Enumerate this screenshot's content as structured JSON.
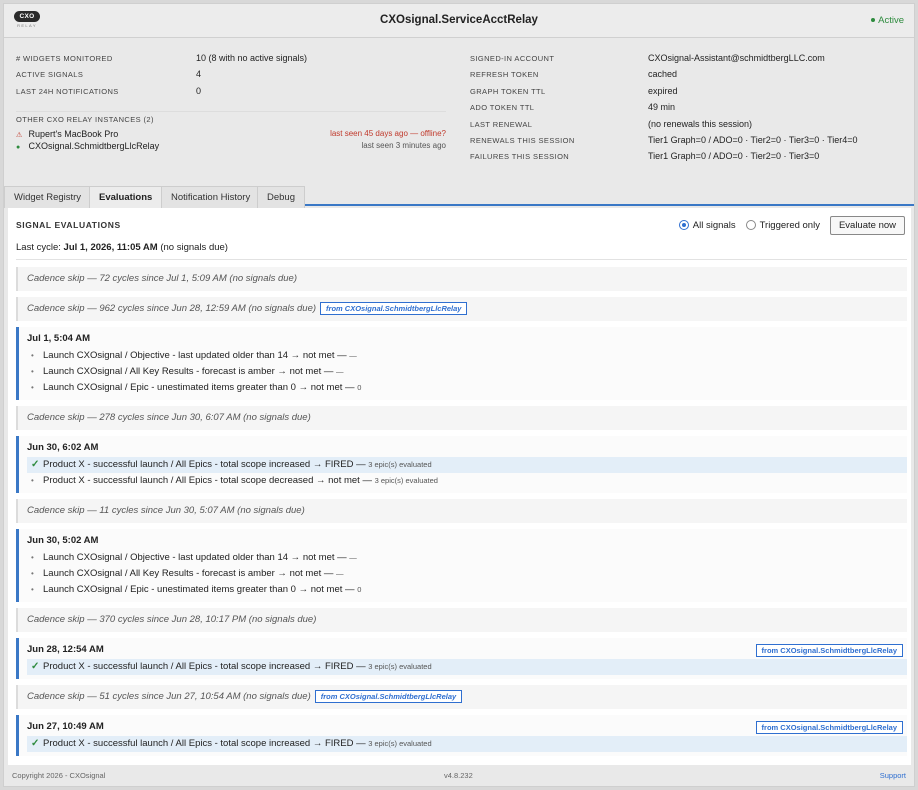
{
  "header": {
    "logo_text": "CXO",
    "logo_sub": "RELAY",
    "title": "CXOsignal.ServiceAcctRelay",
    "status": "Active",
    "status_color": "#2e8b3e"
  },
  "summary": {
    "left": [
      {
        "k": "# WIDGETS MONITORED",
        "v": "10 (8 with no active signals)"
      },
      {
        "k": "ACTIVE SIGNALS",
        "v": "4"
      },
      {
        "k": "LAST 24H NOTIFICATIONS",
        "v": "0"
      }
    ],
    "right": [
      {
        "k": "SIGNED-IN ACCOUNT",
        "v": "CXOsignal-Assistant@schmidtbergLLC.com"
      },
      {
        "k": "REFRESH TOKEN",
        "v": "cached"
      },
      {
        "k": "GRAPH TOKEN TTL",
        "v": "expired"
      },
      {
        "k": "ADO TOKEN TTL",
        "v": "49 min"
      },
      {
        "k": "LAST RENEWAL",
        "v": "(no renewals this session)"
      },
      {
        "k": "RENEWALS THIS SESSION",
        "v": "Tier1 Graph=0 / ADO=0 · Tier2=0 · Tier3=0 · Tier4=0"
      },
      {
        "k": "FAILURES THIS SESSION",
        "v": "Tier1 Graph=0 / ADO=0 · Tier2=0 · Tier3=0"
      }
    ],
    "instances_heading": "OTHER CXO RELAY INSTANCES (2)",
    "instances": [
      {
        "mark": "⚠",
        "name": "Rupert's MacBook Pro",
        "seen": "last seen 45 days ago — offline?",
        "state": "warn"
      },
      {
        "mark": "●",
        "name": "CXOsignal.SchmidtbergLlcRelay",
        "seen": "last seen 3 minutes ago",
        "state": "ok"
      }
    ]
  },
  "tabs": [
    {
      "label": "Widget Registry",
      "active": false
    },
    {
      "label": "Evaluations",
      "active": true
    },
    {
      "label": "Notification History",
      "active": false
    },
    {
      "label": "Debug",
      "active": false
    }
  ],
  "evaluations": {
    "heading": "SIGNAL EVALUATIONS",
    "filter_all": "All signals",
    "filter_triggered": "Triggered only",
    "evaluate_button": "Evaluate now",
    "last_cycle_label": "Last cycle:",
    "last_cycle_time": "Jul 1, 2026, 11:05 AM",
    "last_cycle_note": "(no signals due)",
    "skips": [
      "Cadence skip — 72 cycles since Jul 1, 5:09 AM (no signals due)",
      "Cadence skip — 962 cycles since Jun 28, 12:59 AM (no signals due)",
      "Cadence skip — 278 cycles since Jun 30, 6:07 AM (no signals due)",
      "Cadence skip — 11 cycles since Jun 30, 5:07 AM (no signals due)",
      "Cadence skip — 370 cycles since Jun 28, 10:17 PM (no signals due)",
      "Cadence skip — 51 cycles since Jun 27, 10:54 AM (no signals due)"
    ],
    "relay_tag": "from CXOsignal.SchmidtbergLlcRelay",
    "blocks": [
      {
        "ts": "Jul 1, 5:04 AM",
        "rows": [
          {
            "text": "Launch CXOsignal / Objective - last updated older than 14 → not met — ",
            "det": "—"
          },
          {
            "text": "Launch CXOsignal / All Key Results - forecast is amber → not met — ",
            "det": "—"
          },
          {
            "text": "Launch CXOsignal / Epic - unestimated items greater than 0 → not met — ",
            "det": "0"
          }
        ]
      },
      {
        "ts": "Jun 30, 6:02 AM",
        "rows": [
          {
            "text": "Product X - successful launch / All Epics - total scope increased → FIRED — ",
            "det": "3 epic(s) evaluated"
          },
          {
            "text": "Product X - successful launch / All Epics - total scope decreased → not met — ",
            "det": "3 epic(s) evaluated"
          }
        ]
      },
      {
        "ts": "Jun 30, 5:02 AM",
        "rows": [
          {
            "text": "Launch CXOsignal / Objective - last updated older than 14 → not met — ",
            "det": "—"
          },
          {
            "text": "Launch CXOsignal / All Key Results - forecast is amber → not met — ",
            "det": "—"
          },
          {
            "text": "Launch CXOsignal / Epic - unestimated items greater than 0 → not met — ",
            "det": "0"
          }
        ]
      },
      {
        "ts": "Jun 28, 12:54 AM",
        "rows": [
          {
            "text": "Product X - successful launch / All Epics - total scope increased → FIRED — ",
            "det": "3 epic(s) evaluated"
          }
        ]
      },
      {
        "ts": "Jun 27, 10:49 AM",
        "rows": [
          {
            "text": "Product X - successful launch / All Epics - total scope increased → FIRED — ",
            "det": "3 epic(s) evaluated"
          }
        ]
      }
    ]
  },
  "footer": {
    "copyright": "Copyright 2026 - CXOsignal",
    "version": "v4.8.232",
    "support": "Support"
  }
}
